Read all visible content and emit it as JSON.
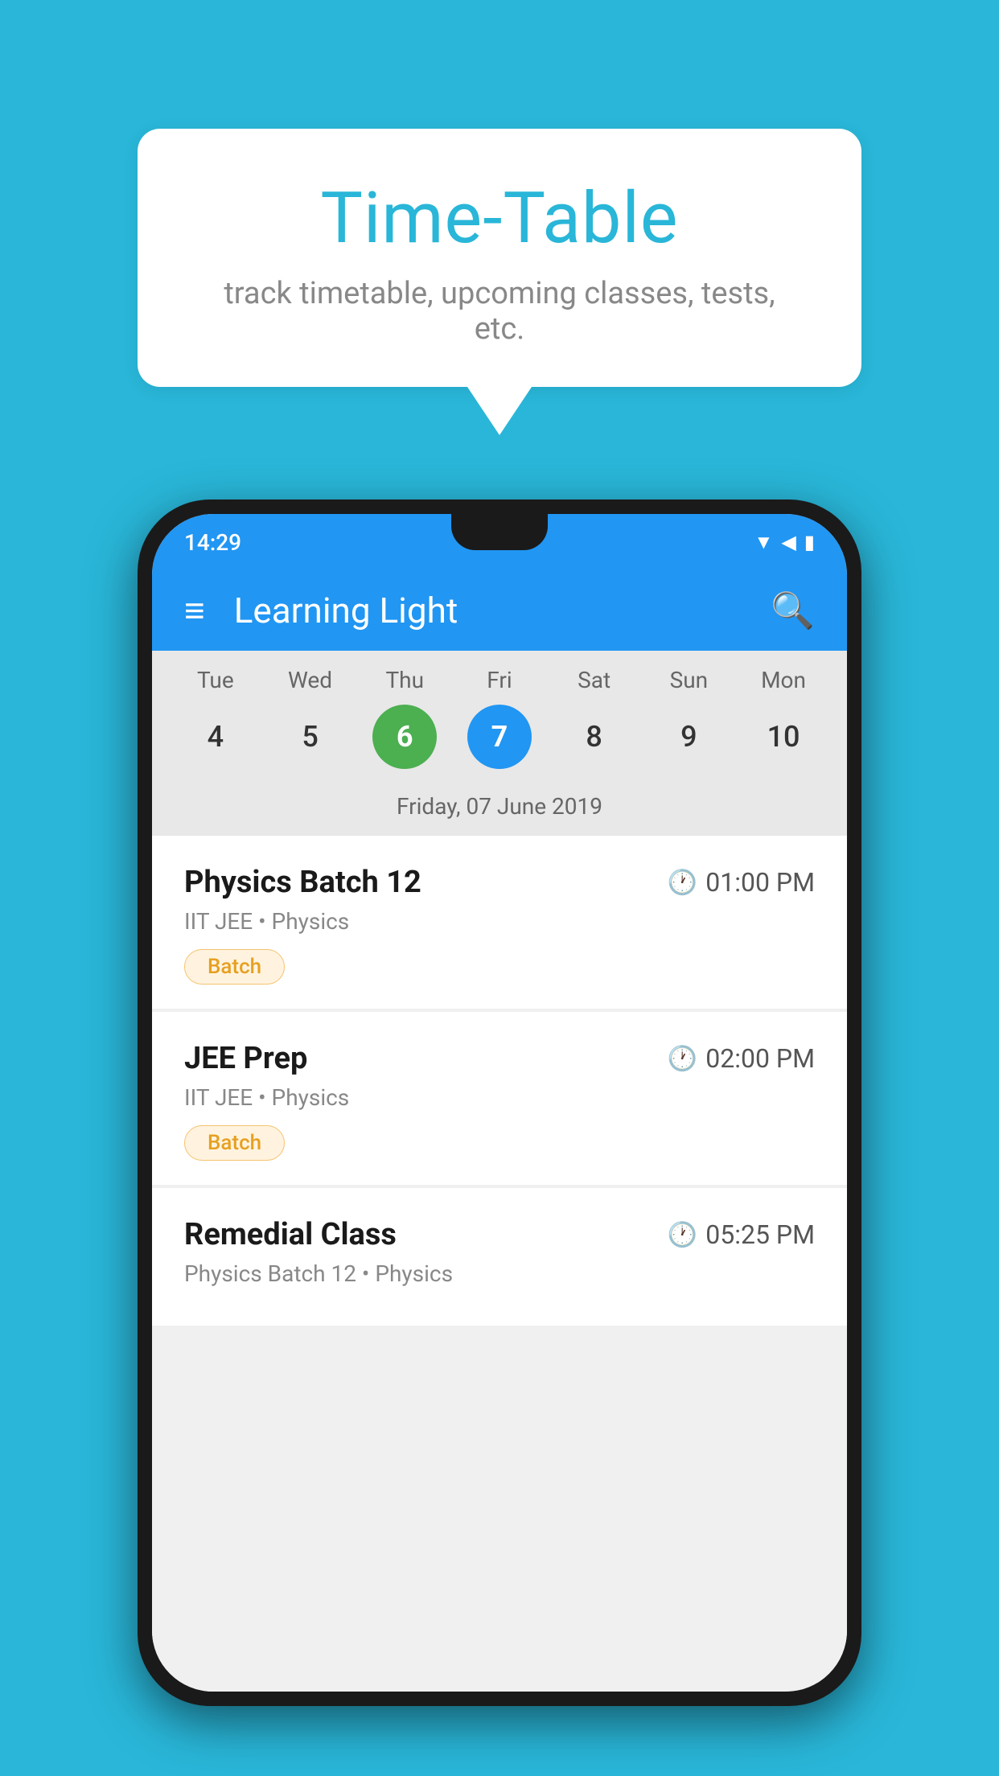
{
  "background_color": "#29b6d8",
  "speech_bubble": {
    "title": "Time-Table",
    "subtitle": "track timetable, upcoming classes, tests, etc."
  },
  "phone": {
    "status_bar": {
      "time": "14:29"
    },
    "app_bar": {
      "title": "Learning Light",
      "hamburger_label": "≡",
      "search_label": "🔍"
    },
    "calendar": {
      "days": [
        {
          "name": "Tue",
          "num": "4",
          "state": "normal"
        },
        {
          "name": "Wed",
          "num": "5",
          "state": "normal"
        },
        {
          "name": "Thu",
          "num": "6",
          "state": "today"
        },
        {
          "name": "Fri",
          "num": "7",
          "state": "selected"
        },
        {
          "name": "Sat",
          "num": "8",
          "state": "normal"
        },
        {
          "name": "Sun",
          "num": "9",
          "state": "normal"
        },
        {
          "name": "Mon",
          "num": "10",
          "state": "normal"
        }
      ],
      "selected_label": "Friday, 07 June 2019"
    },
    "classes": [
      {
        "title": "Physics Batch 12",
        "time": "01:00 PM",
        "meta": "IIT JEE • Physics",
        "badge": "Batch"
      },
      {
        "title": "JEE Prep",
        "time": "02:00 PM",
        "meta": "IIT JEE • Physics",
        "badge": "Batch"
      },
      {
        "title": "Remedial Class",
        "time": "05:25 PM",
        "meta": "Physics Batch 12 • Physics",
        "badge": ""
      }
    ]
  }
}
